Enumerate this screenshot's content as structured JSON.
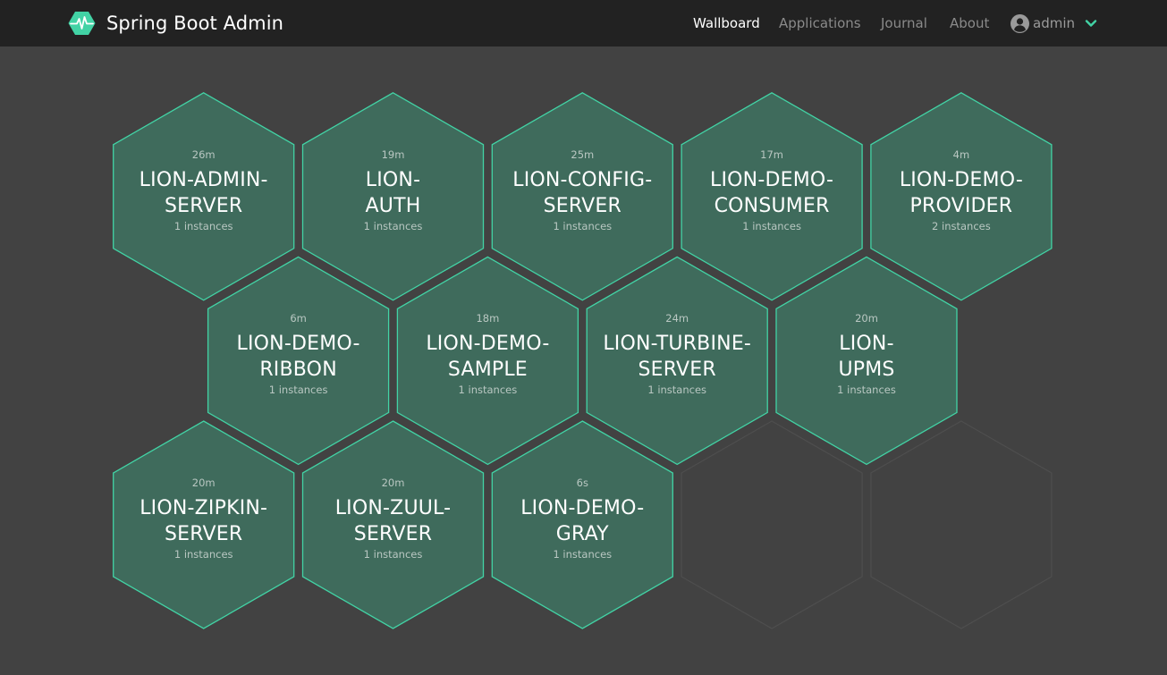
{
  "brand": {
    "title": "Spring Boot Admin",
    "logo_icon": "heartbeat-hexagon-icon",
    "accent_color": "#42d3a5"
  },
  "nav": {
    "wallboard": "Wallboard",
    "applications": "Applications",
    "journal": "Journal",
    "about": "About",
    "active": "Wallboard"
  },
  "user": {
    "name": "admin",
    "icon": "user-circle-icon",
    "menu_icon": "chevron-down-icon"
  },
  "apps": [
    {
      "uptime": "26m",
      "name": "LION-ADMIN-\nSERVER",
      "instances": "1 instances"
    },
    {
      "uptime": "19m",
      "name": "LION-\nAUTH",
      "instances": "1 instances"
    },
    {
      "uptime": "25m",
      "name": "LION-CONFIG-\nSERVER",
      "instances": "1 instances"
    },
    {
      "uptime": "17m",
      "name": "LION-DEMO-\nCONSUMER",
      "instances": "1 instances"
    },
    {
      "uptime": "4m",
      "name": "LION-DEMO-\nPROVIDER",
      "instances": "2 instances"
    },
    {
      "uptime": "6m",
      "name": "LION-DEMO-\nRIBBON",
      "instances": "1 instances"
    },
    {
      "uptime": "18m",
      "name": "LION-DEMO-\nSAMPLE",
      "instances": "1 instances"
    },
    {
      "uptime": "24m",
      "name": "LION-TURBINE-\nSERVER",
      "instances": "1 instances"
    },
    {
      "uptime": "20m",
      "name": "LION-\nUPMS",
      "instances": "1 instances"
    },
    {
      "uptime": "20m",
      "name": "LION-ZIPKIN-\nSERVER",
      "instances": "1 instances"
    },
    {
      "uptime": "20m",
      "name": "LION-ZUUL-\nSERVER",
      "instances": "1 instances"
    },
    {
      "uptime": "6s",
      "name": "LION-DEMO-\nGRAY",
      "instances": "1 instances"
    }
  ],
  "colors": {
    "navbar_bg": "#222222",
    "page_bg": "#424242",
    "hex_fill": "#3f6b5c",
    "hex_border": "#42d3a5",
    "empty_hex_border": "#4e4e4e"
  }
}
